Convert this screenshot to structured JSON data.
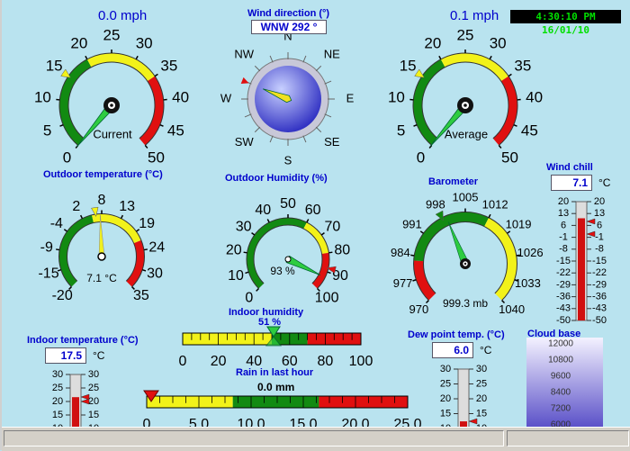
{
  "wind_speed": {
    "current_label": "0.0 mph",
    "average_label": "0.1 mph",
    "ticks": [
      "0",
      "5",
      "10",
      "15",
      "20",
      "25",
      "30",
      "35",
      "40",
      "45",
      "50"
    ],
    "current_caption": "Current",
    "average_caption": "Average",
    "current_value": 0.0,
    "average_value": 0.1
  },
  "wind_direction": {
    "title": "Wind direction (°)",
    "value": "WNW  292 °",
    "points": [
      "N",
      "NE",
      "E",
      "SE",
      "S",
      "SW",
      "W",
      "NW"
    ],
    "bearing": 292
  },
  "clock": "4:30:10 PM 16/01/10",
  "outdoor_temp": {
    "title": "Outdoor temperature (°C)",
    "ticks": [
      "-20",
      "-15",
      "-9",
      "-4",
      "2",
      "8",
      "13",
      "19",
      "24",
      "30",
      "35"
    ],
    "value_text": "7.1 °C",
    "value": 7.1
  },
  "outdoor_humidity": {
    "title": "Outdoor Humidity (%)",
    "ticks": [
      "0",
      "10",
      "20",
      "30",
      "40",
      "50",
      "60",
      "70",
      "80",
      "90",
      "100"
    ],
    "value_text": "93 %",
    "value": 93
  },
  "barometer": {
    "title": "Barometer",
    "ticks": [
      "970",
      "977",
      "984",
      "991",
      "998",
      "1005",
      "1012",
      "1019",
      "1026",
      "1033",
      "1040"
    ],
    "value_text": "999.3 mb",
    "value": 999.3
  },
  "wind_chill": {
    "title": "Wind chill",
    "value": "7.1",
    "unit": "°C",
    "ticks": [
      "20",
      "13",
      "6",
      "-1",
      "-8",
      "-15",
      "-22",
      "-29",
      "-36",
      "-43",
      "-50"
    ]
  },
  "indoor_humidity": {
    "title": "Indoor humidity",
    "value_text": "51 %",
    "ticks": [
      "0",
      "20",
      "40",
      "60",
      "80",
      "100"
    ],
    "value": 51
  },
  "rain": {
    "title": "Rain in last hour",
    "value_text": "0.0 mm",
    "ticks": [
      "0",
      "5.0",
      "10.0",
      "15.0",
      "20.0",
      "25.0"
    ]
  },
  "indoor_temp": {
    "title": "Indoor temperature (°C)",
    "value": "17.5",
    "unit": "°C",
    "ticks": [
      "30",
      "25",
      "20",
      "15",
      "10"
    ]
  },
  "dew_point": {
    "title": "Dew point temp. (°C)",
    "value": "6.0",
    "unit": "°C",
    "ticks": [
      "30",
      "25",
      "20",
      "15",
      "10"
    ]
  },
  "cloud_base": {
    "title": "Cloud base",
    "ticks": [
      "12000",
      "10800",
      "9600",
      "8400",
      "7200",
      "6000"
    ]
  },
  "colors": {
    "label": "#0000cc",
    "green": "#128a12",
    "yellow": "#f2f21a",
    "red": "#e01010",
    "background": "#b9e3ef"
  }
}
